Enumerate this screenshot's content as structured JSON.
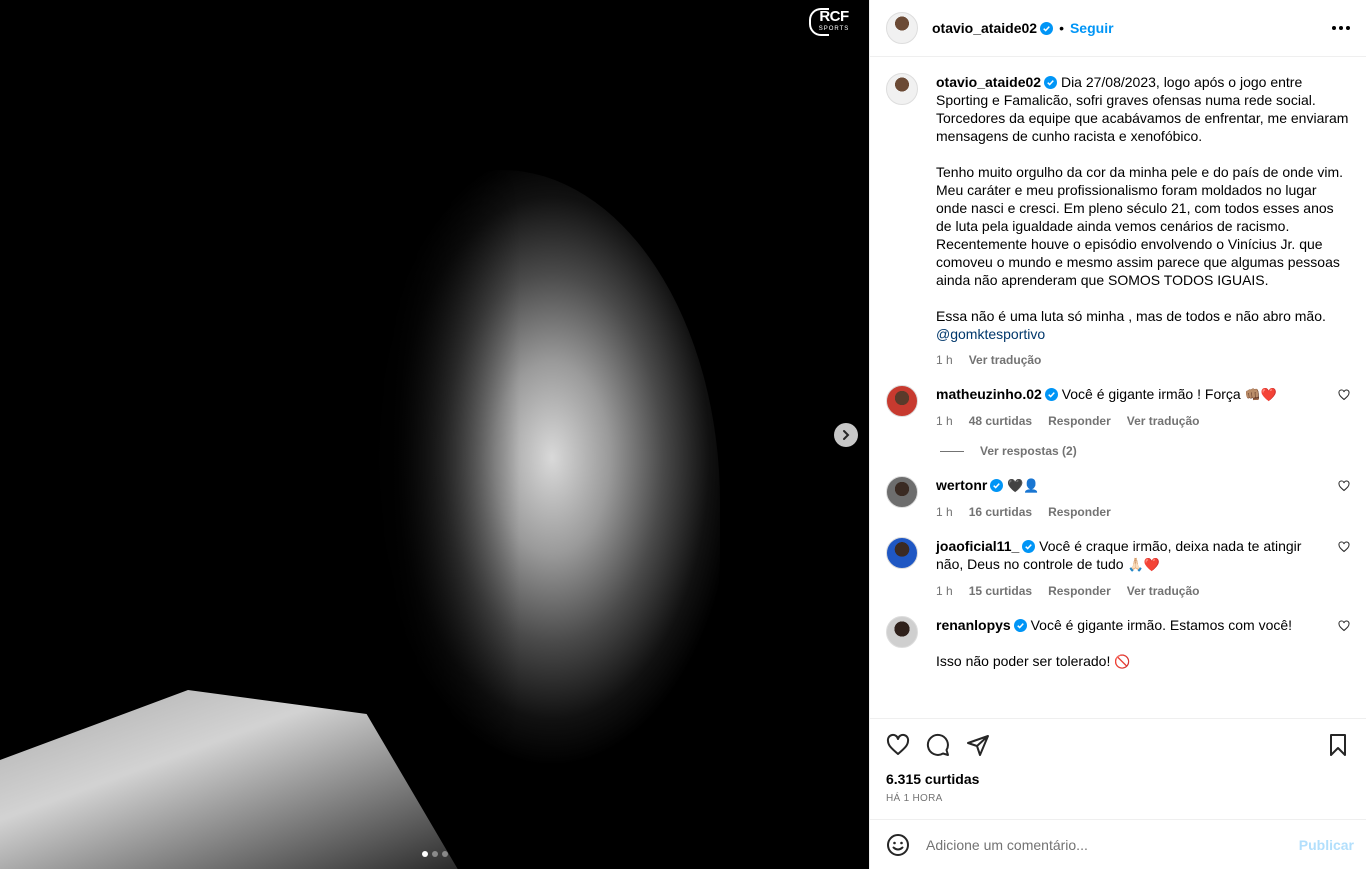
{
  "media": {
    "logo_main": "RCF",
    "logo_sub": "SPORTS",
    "next_icon": "chevron-right-icon"
  },
  "header": {
    "username": "otavio_ataide02",
    "separator": "•",
    "follow_label": "Seguir"
  },
  "caption": {
    "username": "otavio_ataide02",
    "text": "Dia 27/08/2023, logo após o jogo entre Sporting e Famalicão, sofri graves ofensas numa rede social. Torcedores da equipe que acabávamos de enfrentar, me enviaram mensagens de cunho racista e xenofóbico.\n\nTenho muito orgulho da cor da minha pele e do país de onde vim.\nMeu caráter e meu profissionalismo foram moldados no lugar onde nasci e cresci. Em pleno século 21, com todos esses anos de luta pela igualdade ainda vemos cenários de racismo. Recentemente houve o episódio envolvendo o Vinícius Jr. que comoveu o mundo e mesmo assim parece que algumas pessoas ainda não aprenderam que SOMOS TODOS IGUAIS.\n\nEssa não é uma luta só minha , mas de todos e não abro mão.",
    "mention": "@gomktesportivo",
    "time": "1 h",
    "translate": "Ver tradução"
  },
  "comments": [
    {
      "username": "matheuzinho.02",
      "text": "Você é gigante irmão ! Força",
      "emoji": "👊🏽❤️",
      "time": "1 h",
      "likes": "48 curtidas",
      "reply": "Responder",
      "translate": "Ver tradução",
      "view_replies": "Ver respostas (2)"
    },
    {
      "username": "wertonr",
      "text": "",
      "emoji": "🖤👤",
      "time": "1 h",
      "likes": "16 curtidas",
      "reply": "Responder"
    },
    {
      "username": "joaoficial11_",
      "text": "Você é craque irmão, deixa nada te atingir não, Deus no controle de tudo",
      "emoji": "🙏🏻❤️",
      "time": "1 h",
      "likes": "15 curtidas",
      "reply": "Responder",
      "translate": "Ver tradução"
    },
    {
      "username": "renanlopys",
      "text": "Você é gigante irmão. Estamos com você!\n\nIsso não poder ser tolerado!",
      "emoji": "🚫"
    }
  ],
  "footer": {
    "likes": "6.315 curtidas",
    "time": "HÁ 1 HORA",
    "comment_placeholder": "Adicione um comentário...",
    "publish_label": "Publicar"
  },
  "colors": {
    "accent": "#0095f6",
    "secondary_text": "#737373",
    "heart": "#ed4956"
  }
}
